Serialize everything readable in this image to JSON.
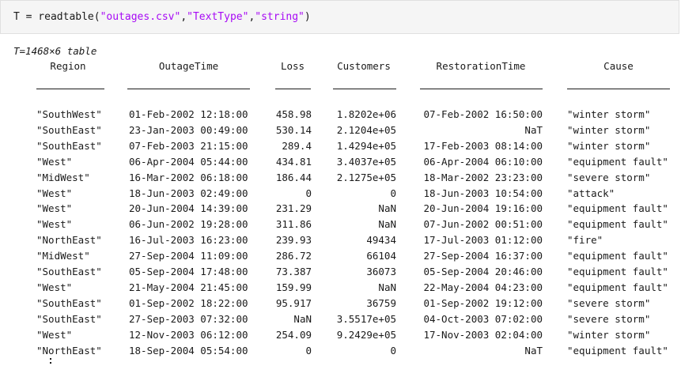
{
  "command": {
    "prefix": "T = readtable(",
    "arg1": "\"outages.csv\"",
    "sep1": ",",
    "arg2": "\"TextType\"",
    "sep2": ",",
    "arg3": "\"string\"",
    "suffix": ")"
  },
  "table_summary": "T=1468×6 table",
  "columns": [
    "Region",
    "OutageTime",
    "Loss",
    "Customers",
    "RestorationTime",
    "Cause"
  ],
  "rows": [
    [
      "\"SouthWest\"",
      "01-Feb-2002 12:18:00",
      "458.98",
      "1.8202e+06",
      "07-Feb-2002 16:50:00",
      "\"winter storm\""
    ],
    [
      "\"SouthEast\"",
      "23-Jan-2003 00:49:00",
      "530.14",
      "2.1204e+05",
      "NaT",
      "\"winter storm\""
    ],
    [
      "\"SouthEast\"",
      "07-Feb-2003 21:15:00",
      "289.4",
      "1.4294e+05",
      "17-Feb-2003 08:14:00",
      "\"winter storm\""
    ],
    [
      "\"West\"",
      "06-Apr-2004 05:44:00",
      "434.81",
      "3.4037e+05",
      "06-Apr-2004 06:10:00",
      "\"equipment fault\""
    ],
    [
      "\"MidWest\"",
      "16-Mar-2002 06:18:00",
      "186.44",
      "2.1275e+05",
      "18-Mar-2002 23:23:00",
      "\"severe storm\""
    ],
    [
      "\"West\"",
      "18-Jun-2003 02:49:00",
      "0",
      "0",
      "18-Jun-2003 10:54:00",
      "\"attack\""
    ],
    [
      "\"West\"",
      "20-Jun-2004 14:39:00",
      "231.29",
      "NaN",
      "20-Jun-2004 19:16:00",
      "\"equipment fault\""
    ],
    [
      "\"West\"",
      "06-Jun-2002 19:28:00",
      "311.86",
      "NaN",
      "07-Jun-2002 00:51:00",
      "\"equipment fault\""
    ],
    [
      "\"NorthEast\"",
      "16-Jul-2003 16:23:00",
      "239.93",
      "49434",
      "17-Jul-2003 01:12:00",
      "\"fire\""
    ],
    [
      "\"MidWest\"",
      "27-Sep-2004 11:09:00",
      "286.72",
      "66104",
      "27-Sep-2004 16:37:00",
      "\"equipment fault\""
    ],
    [
      "\"SouthEast\"",
      "05-Sep-2004 17:48:00",
      "73.387",
      "36073",
      "05-Sep-2004 20:46:00",
      "\"equipment fault\""
    ],
    [
      "\"West\"",
      "21-May-2004 21:45:00",
      "159.99",
      "NaN",
      "22-May-2004 04:23:00",
      "\"equipment fault\""
    ],
    [
      "\"SouthEast\"",
      "01-Sep-2002 18:22:00",
      "95.917",
      "36759",
      "01-Sep-2002 19:12:00",
      "\"severe storm\""
    ],
    [
      "\"SouthEast\"",
      "27-Sep-2003 07:32:00",
      "NaN",
      "3.5517e+05",
      "04-Oct-2003 07:02:00",
      "\"severe storm\""
    ],
    [
      "\"West\"",
      "12-Nov-2003 06:12:00",
      "254.09",
      "9.2429e+05",
      "17-Nov-2003 02:04:00",
      "\"winter storm\""
    ],
    [
      "\"NorthEast\"",
      "18-Sep-2004 05:54:00",
      "0",
      "0",
      "NaT",
      "\"equipment fault\""
    ]
  ],
  "more_rows_indicator": "vertical-ellipsis"
}
